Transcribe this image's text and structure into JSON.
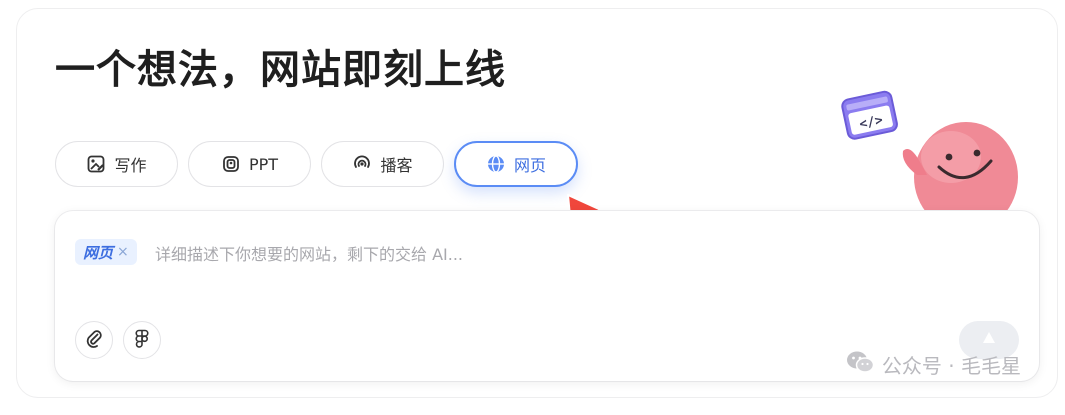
{
  "title": "一个想法，网站即刻上线",
  "tabs": [
    {
      "label": "写作",
      "icon": "image-pen-icon"
    },
    {
      "label": "PPT",
      "icon": "ppt-icon"
    },
    {
      "label": "播客",
      "icon": "podcast-icon"
    },
    {
      "label": "网页",
      "icon": "globe-icon",
      "active": true
    }
  ],
  "input": {
    "chip_label": "网页",
    "chip_close": "×",
    "placeholder": "详细描述下你想要的网站，剩下的交给 AI..."
  },
  "tools": {
    "attach_icon": "paperclip-icon",
    "figma_icon": "figma-icon",
    "send_icon": "send-up-icon"
  },
  "watermark": {
    "text": "公众号 · 毛毛星"
  },
  "colors": {
    "accent": "#5b8cf5",
    "cursor": "#f0473c",
    "mascot": "#f08a96",
    "chip_bg": "#e9f1ff"
  }
}
